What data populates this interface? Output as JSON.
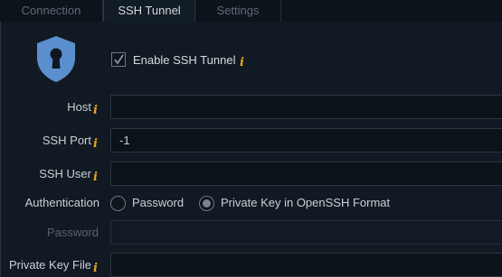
{
  "tabs": [
    {
      "label": "Connection",
      "active": false
    },
    {
      "label": "SSH Tunnel",
      "active": true
    },
    {
      "label": "Settings",
      "active": false
    }
  ],
  "enable_tunnel": {
    "label": "Enable SSH Tunnel",
    "checked": true
  },
  "info_glyph": "i",
  "fields": {
    "host": {
      "label": "Host",
      "value": ""
    },
    "ssh_port": {
      "label": "SSH Port",
      "value": "-1"
    },
    "ssh_user": {
      "label": "SSH User",
      "value": ""
    },
    "password": {
      "label": "Password",
      "value": ""
    },
    "private_key_file": {
      "label": "Private Key File",
      "value": ""
    }
  },
  "authentication": {
    "label": "Authentication",
    "options": [
      "Password",
      "Private Key in OpenSSH Format"
    ],
    "selected": "Private Key in OpenSSH Format"
  },
  "colors": {
    "info_accent": "#e2a623",
    "shield": "#5b8fd0"
  },
  "icons": {
    "shield": "shield-keyhole-icon",
    "check": "checkmark-icon",
    "info": "info-icon"
  }
}
